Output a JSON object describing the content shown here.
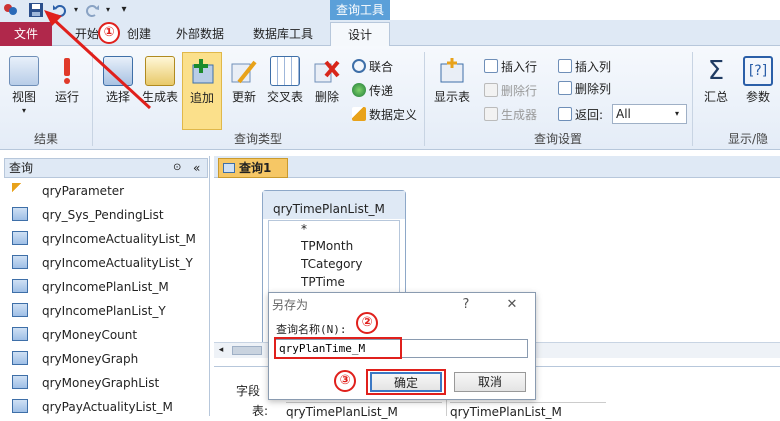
{
  "quick_access": {
    "save_icon": "save-icon",
    "undo_icon": "undo-icon",
    "redo_icon": "redo-icon"
  },
  "tabs": {
    "context_header": "查询工具",
    "file": "文件",
    "home": "开始",
    "create": "创建",
    "external": "外部数据",
    "dbtools": "数据库工具",
    "design": "设计"
  },
  "ribbon": {
    "view": "视图",
    "run": "运行",
    "select": "选择",
    "make_table": "生成表",
    "append": "追加",
    "update": "更新",
    "crosstab": "交叉表",
    "delete": "删除",
    "union": "联合",
    "pass_through": "传递",
    "data_definition": "数据定义",
    "show_table": "显示表",
    "insert_row": "插入行",
    "delete_row": "删除行",
    "builder": "生成器",
    "insert_col": "插入列",
    "delete_col": "删除列",
    "return_label": "返回:",
    "return_value": "All",
    "totals": "汇总",
    "params": "参数",
    "group_results": "结果",
    "group_query_type": "查询类型",
    "group_query_setup": "查询设置",
    "group_show_hide": "显示/隐"
  },
  "nav": {
    "header": "查询",
    "items": [
      "qryParameter",
      "qry_Sys_PendingList",
      "qryIncomeActualityList_M",
      "qryIncomeActualityList_Y",
      "qryIncomePlanList_M",
      "qryIncomePlanList_Y",
      "qryMoneyCount",
      "qryMoneyGraph",
      "qryMoneyGraphList",
      "qryPayActualityList_M"
    ]
  },
  "document": {
    "tab": "查询1",
    "table_name": "qryTimePlanList_M",
    "fields": [
      "*",
      "TPMonth",
      "TCategory",
      "TPTime"
    ],
    "grid_field_label": "字段",
    "grid_table_label": "表:",
    "grid_field_values": [
      "",
      ""
    ],
    "grid_table_values": [
      "qryTimePlanList_M",
      "qryTimePlanList_M"
    ]
  },
  "dialog": {
    "title": "另存为",
    "help": "?",
    "close": "✕",
    "label": "查询名称(N):",
    "value": "qryPlanTime_M",
    "ok": "确定",
    "cancel": "取消"
  },
  "annotations": [
    "①",
    "②",
    "③"
  ],
  "colors": {
    "file_tab": "#b0284b",
    "context": "#5ba0d9",
    "annotation": "#e0201c",
    "doc_tab": "#f6c765"
  }
}
